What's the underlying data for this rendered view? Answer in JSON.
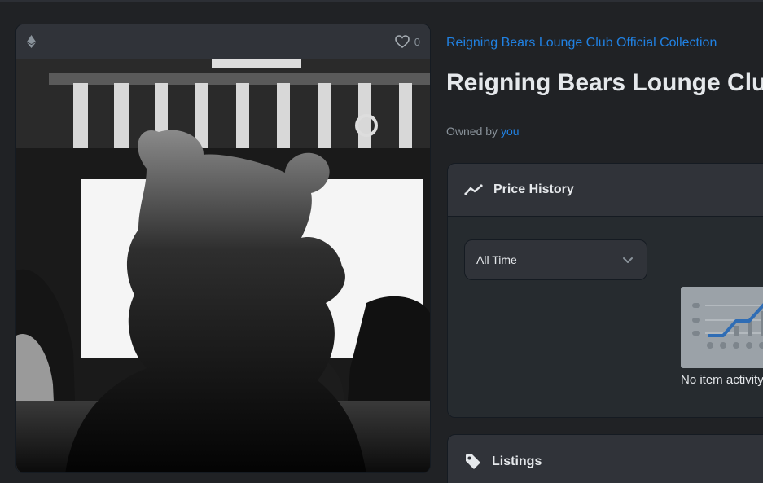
{
  "card": {
    "favorites_count": "0",
    "icons": {
      "chain": "ethereum-icon",
      "favorite": "heart-icon"
    }
  },
  "item": {
    "collection_name": "Reigning Bears Lounge Club Official Collection",
    "title": "Reigning Bears Lounge Club",
    "owned_by_label": "Owned by",
    "owner": "you"
  },
  "price_history": {
    "title": "Price History",
    "icon": "trending-chart-icon",
    "time_filter": "All Time",
    "empty_message": "No item activity yet"
  },
  "listings": {
    "title": "Listings",
    "icon": "tag-icon"
  },
  "colors": {
    "background": "#202225",
    "card": "#303339",
    "link": "#2081e2",
    "text": "#e5e8eb",
    "muted": "#8a939b"
  }
}
